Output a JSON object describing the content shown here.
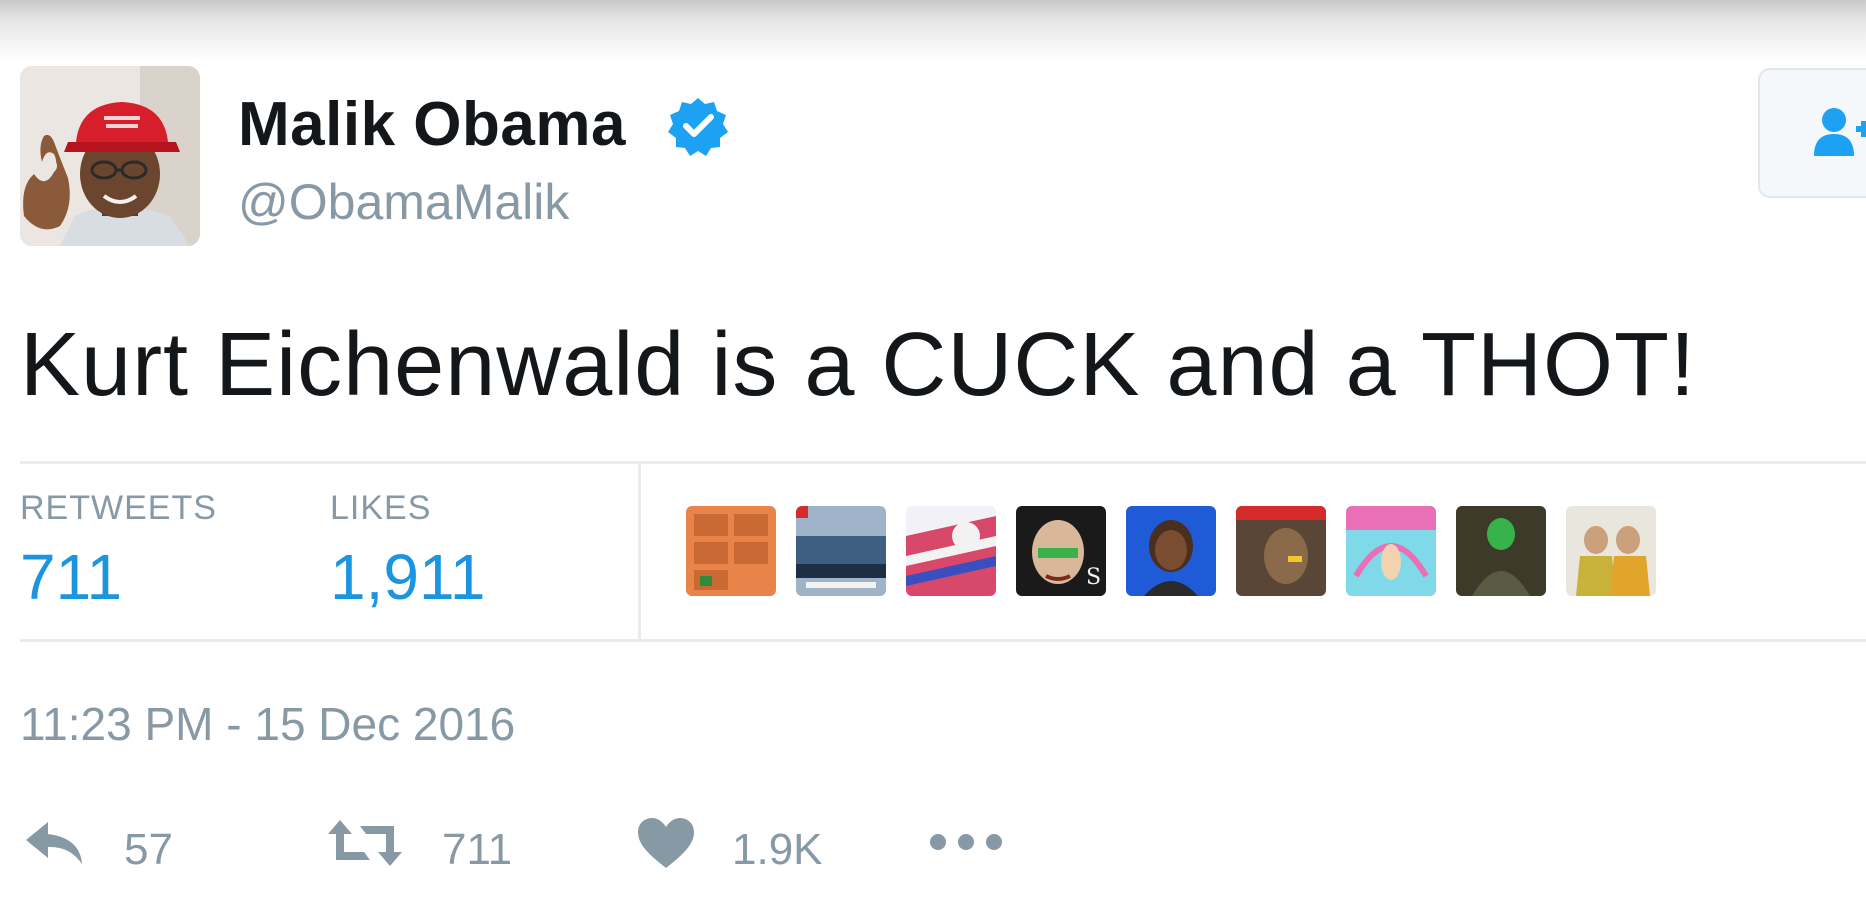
{
  "user": {
    "display_name": "Malik Obama",
    "username": "@ObamaMalik",
    "verified": true,
    "verified_color": "#1da1f2",
    "avatar_icon": "avatar"
  },
  "follow_button": {
    "icon": "follow-user-icon",
    "color": "#1da1f2"
  },
  "tweet": {
    "text": "Kurt Eichenwald is a CUCK and a THOT!",
    "timestamp": "11:23 PM - 15 Dec 2016"
  },
  "stats": {
    "retweets_label": "RETWEETS",
    "retweets_value": "711",
    "likes_label": "LIKES",
    "likes_value": "1,911",
    "value_color": "#1b95e0"
  },
  "likers": [
    {
      "icon": "liker-avatar-1",
      "color": "#e8844a"
    },
    {
      "icon": "liker-avatar-2",
      "color": "#3f5f82"
    },
    {
      "icon": "liker-avatar-3",
      "color": "#d8486a"
    },
    {
      "icon": "liker-avatar-4",
      "color": "#1a1a1a"
    },
    {
      "icon": "liker-avatar-5",
      "color": "#1f5bd6"
    },
    {
      "icon": "liker-avatar-6",
      "color": "#5a4636"
    },
    {
      "icon": "liker-avatar-7",
      "color": "#7fd9e8"
    },
    {
      "icon": "liker-avatar-8",
      "color": "#3d3a2a"
    },
    {
      "icon": "liker-avatar-9",
      "color": "#c9b23a"
    }
  ],
  "actions": {
    "reply_icon": "reply-icon",
    "reply_count": "57",
    "retweet_icon": "retweet-icon",
    "retweet_count": "711",
    "like_icon": "heart-icon",
    "like_count": "1.9K",
    "more_icon": "more-icon"
  }
}
